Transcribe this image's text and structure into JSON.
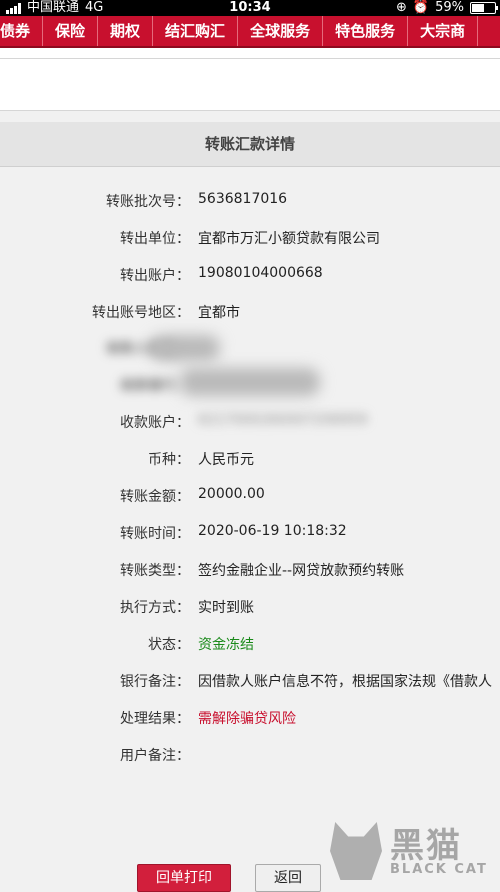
{
  "status_bar": {
    "carrier": "中国联通",
    "network": "4G",
    "time": "10:34",
    "battery": "59%",
    "battery_level": 0.59
  },
  "nav": {
    "items": [
      "债券",
      "保险",
      "期权",
      "结汇购汇",
      "全球服务",
      "特色服务",
      "大宗商"
    ]
  },
  "detail": {
    "title": "转账汇款详情",
    "rows": [
      {
        "label": "转账批次号：",
        "value": "5636817016"
      },
      {
        "label": "转出单位：",
        "value": "宜都市万汇小额贷款有限公司"
      },
      {
        "label": "转出账户：",
        "value": "19080104000668"
      },
      {
        "label": "转出账号地区：",
        "value": "宜都市"
      },
      {
        "label": "收款人姓名：",
        "value": ""
      },
      {
        "label": "收款银行：",
        "value": ""
      },
      {
        "label": "收款账户：",
        "value": "6217000260007206959"
      },
      {
        "label": "币种：",
        "value": "人民币元"
      },
      {
        "label": "转账金额：",
        "value": "20000.00"
      },
      {
        "label": "转账时间：",
        "value": "2020-06-19 10:18:32"
      },
      {
        "label": "转账类型：",
        "value": "签约金融企业--网贷放款预约转账"
      },
      {
        "label": "执行方式：",
        "value": "实时到账"
      },
      {
        "label": "状态：",
        "value": "资金冻结"
      },
      {
        "label": "银行备注：",
        "value": "因借款人账户信息不符，根据国家法规《借款人"
      },
      {
        "label": "处理结果：",
        "value": "需解除骗贷风险"
      },
      {
        "label": "用户备注：",
        "value": ""
      }
    ]
  },
  "buttons": {
    "print": "回单打印",
    "back": "返回"
  },
  "watermark": {
    "cn": "黑猫",
    "en": "BLACK CAT"
  },
  "colors": {
    "nav_red": "#c8102e",
    "status_green": "#1a8a1a",
    "result_red": "#c8102e"
  }
}
